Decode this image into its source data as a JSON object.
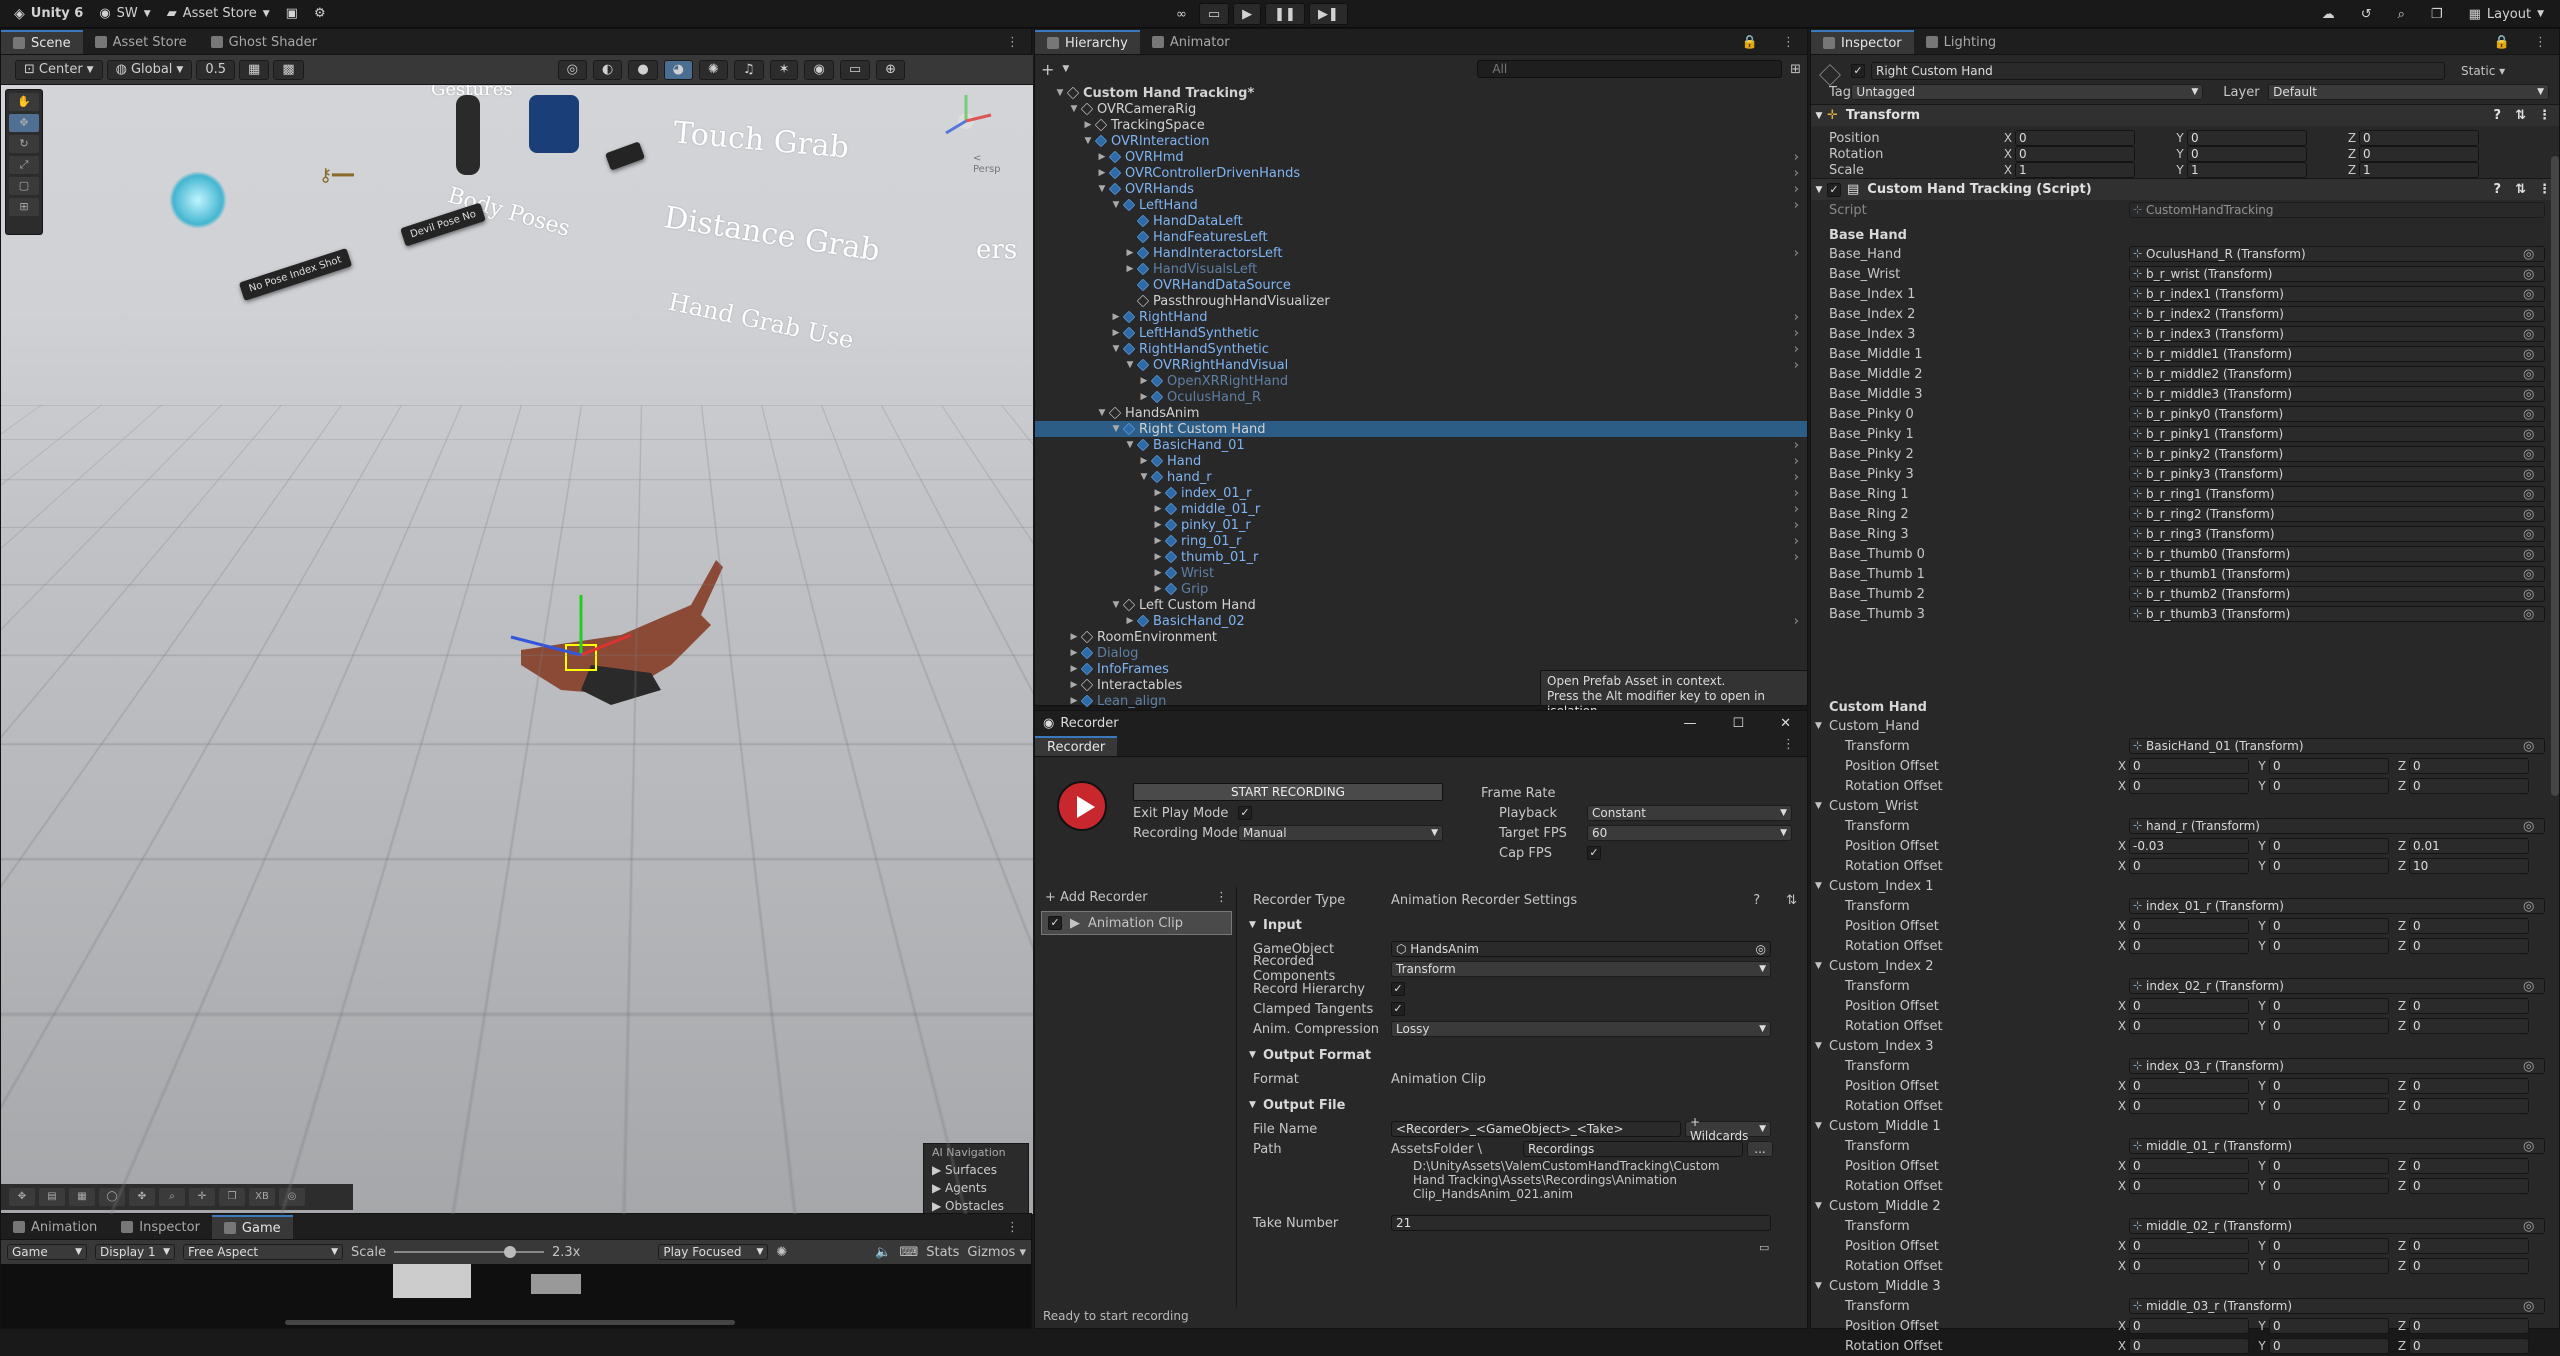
{
  "topbar": {
    "app": "Unity 6",
    "account": "SW",
    "asset_store": "Asset Store",
    "layout": "Layout"
  },
  "scene_tabs": [
    "Scene",
    "Asset Store",
    "Ghost Shader"
  ],
  "scene_toolbar": {
    "pivot": "Center",
    "space": "Global",
    "snap": "0.5"
  },
  "scene_world": {
    "labels": [
      "Touch Grab",
      "Distance Grab",
      "Hand Grab Use",
      "Body Poses",
      "Gestures",
      "ers"
    ],
    "persp": "< Persp",
    "signs": [
      "No Pose Index Shot",
      "Devil Pose No"
    ]
  },
  "scene_bottom_tools": [
    "XB"
  ],
  "navpanel": {
    "title": "AI Navigation",
    "items": [
      "Surfaces",
      "Agents",
      "Obstacles"
    ]
  },
  "game": {
    "tabs": [
      "Animation",
      "Inspector",
      "Game"
    ],
    "display_mode": "Game",
    "display": "Display 1",
    "aspect": "Free Aspect",
    "scale_label": "Scale",
    "scale_value": "2.3x",
    "play_mode": "Play Focused",
    "stats": "Stats",
    "gizmos": "Gizmos"
  },
  "hierarchy": {
    "tabs": [
      "Hierarchy",
      "Animator"
    ],
    "search_placeholder": "All",
    "rows": [
      {
        "name": "Custom Hand Tracking*",
        "depth": 0,
        "style": "bold",
        "arrow": "▼"
      },
      {
        "name": "OVRCameraRig",
        "depth": 1,
        "style": "",
        "arrow": "▼"
      },
      {
        "name": "TrackingSpace",
        "depth": 2,
        "style": "",
        "arrow": "▶"
      },
      {
        "name": "OVRInteraction",
        "depth": 2,
        "style": "blue",
        "arrow": "▼"
      },
      {
        "name": "OVRHmd",
        "depth": 3,
        "style": "blue",
        "arrow": "▶"
      },
      {
        "name": "OVRControllerDrivenHands",
        "depth": 3,
        "style": "blue",
        "arrow": "▶"
      },
      {
        "name": "OVRHands",
        "depth": 3,
        "style": "blue",
        "arrow": "▼"
      },
      {
        "name": "LeftHand",
        "depth": 4,
        "style": "blue",
        "arrow": "▼"
      },
      {
        "name": "HandDataLeft",
        "depth": 5,
        "style": "blue",
        "arrow": ""
      },
      {
        "name": "HandFeaturesLeft",
        "depth": 5,
        "style": "blue",
        "arrow": ""
      },
      {
        "name": "HandInteractorsLeft",
        "depth": 5,
        "style": "blue",
        "arrow": "▶"
      },
      {
        "name": "HandVisualsLeft",
        "depth": 5,
        "style": "dim",
        "arrow": "▶"
      },
      {
        "name": "OVRHandDataSource",
        "depth": 5,
        "style": "blue",
        "arrow": ""
      },
      {
        "name": "PassthroughHandVisualizer",
        "depth": 5,
        "style": "",
        "arrow": ""
      },
      {
        "name": "RightHand",
        "depth": 4,
        "style": "blue",
        "arrow": "▶"
      },
      {
        "name": "LeftHandSynthetic",
        "depth": 4,
        "style": "blue",
        "arrow": "▶"
      },
      {
        "name": "RightHandSynthetic",
        "depth": 4,
        "style": "blue",
        "arrow": "▼"
      },
      {
        "name": "OVRRightHandVisual",
        "depth": 5,
        "style": "blue",
        "arrow": "▼"
      },
      {
        "name": "OpenXRRightHand",
        "depth": 6,
        "style": "dim",
        "arrow": "▶"
      },
      {
        "name": "OculusHand_R",
        "depth": 6,
        "style": "dim",
        "arrow": "▶"
      },
      {
        "name": "HandsAnim",
        "depth": 3,
        "style": "",
        "arrow": "▼"
      },
      {
        "name": "Right Custom Hand",
        "depth": 4,
        "style": "sel",
        "arrow": "▼"
      },
      {
        "name": "BasicHand_01",
        "depth": 5,
        "style": "blue",
        "arrow": "▼"
      },
      {
        "name": "Hand",
        "depth": 6,
        "style": "blue",
        "arrow": "▶"
      },
      {
        "name": "hand_r",
        "depth": 6,
        "style": "blue",
        "arrow": "▼"
      },
      {
        "name": "index_01_r",
        "depth": 7,
        "style": "blue",
        "arrow": "▶"
      },
      {
        "name": "middle_01_r",
        "depth": 7,
        "style": "blue",
        "arrow": "▶"
      },
      {
        "name": "pinky_01_r",
        "depth": 7,
        "style": "blue",
        "arrow": "▶"
      },
      {
        "name": "ring_01_r",
        "depth": 7,
        "style": "blue",
        "arrow": "▶"
      },
      {
        "name": "thumb_01_r",
        "depth": 7,
        "style": "blue",
        "arrow": "▶"
      },
      {
        "name": "Wrist",
        "depth": 7,
        "style": "dim",
        "arrow": "▶"
      },
      {
        "name": "Grip",
        "depth": 7,
        "style": "dim",
        "arrow": "▶"
      },
      {
        "name": "Left Custom Hand",
        "depth": 4,
        "style": "",
        "arrow": "▼"
      },
      {
        "name": "BasicHand_02",
        "depth": 5,
        "style": "blue",
        "arrow": "▶"
      },
      {
        "name": "RoomEnvironment",
        "depth": 1,
        "style": "",
        "arrow": "▶"
      },
      {
        "name": "Dialog",
        "depth": 1,
        "style": "dim",
        "arrow": "▶"
      },
      {
        "name": "InfoFrames",
        "depth": 1,
        "style": "blue",
        "arrow": "▶"
      },
      {
        "name": "Interactables",
        "depth": 1,
        "style": "",
        "arrow": "▶"
      },
      {
        "name": "Lean_align",
        "depth": 1,
        "style": "dim",
        "arrow": "▶"
      }
    ],
    "tooltip": [
      "Open Prefab Asset in context.",
      "Press the Alt modifier key to open in isolation."
    ]
  },
  "recorder": {
    "window_title": "Recorder",
    "tab": "Recorder",
    "start_button": "START RECORDING",
    "exit_play_mode": "Exit Play Mode",
    "recording_mode_label": "Recording Mode",
    "recording_mode": "Manual",
    "frame_rate": "Frame Rate",
    "playback_label": "Playback",
    "playback": "Constant",
    "target_fps_label": "Target FPS",
    "target_fps": "60",
    "cap_fps": "Cap FPS",
    "add_recorder": "+ Add Recorder",
    "recorder_item": "Animation Clip",
    "recorder_type_label": "Recorder Type",
    "recorder_type": "Animation Recorder Settings",
    "input": "Input",
    "gameobject_label": "GameObject",
    "gameobject": "HandsAnim",
    "recorded_components_label": "Recorded Components",
    "recorded_components": "Transform",
    "record_hierarchy": "Record Hierarchy",
    "clamped_tangents": "Clamped Tangents",
    "anim_compression_label": "Anim. Compression",
    "anim_compression": "Lossy",
    "output_format": "Output Format",
    "format_label": "Format",
    "format": "Animation Clip",
    "output_file": "Output File",
    "file_name_label": "File Name",
    "file_name": "<Recorder>_<GameObject>_<Take>",
    "wildcards": "+ Wildcards",
    "path_label": "Path",
    "path_root": "AssetsFolder \\",
    "path_folder": "Recordings",
    "path_browse": "...",
    "full_path": [
      "D:\\UnityAssets\\ValemCustomHandTracking\\Custom",
      "Hand Tracking\\Assets\\Recordings\\Animation",
      "Clip_HandsAnim_021.anim"
    ],
    "take_number_label": "Take Number",
    "take_number": "21",
    "status": "Ready to start recording"
  },
  "inspector": {
    "tabs": [
      "Inspector",
      "Lighting"
    ],
    "object_name": "Right Custom Hand",
    "static": "Static",
    "tag_label": "Tag",
    "tag": "Untagged",
    "layer_label": "Layer",
    "layer": "Default",
    "transform_title": "Transform",
    "transform": [
      {
        "label": "Position",
        "x": "0",
        "y": "0",
        "z": "0"
      },
      {
        "label": "Rotation",
        "x": "0",
        "y": "0",
        "z": "0"
      },
      {
        "label": "Scale",
        "x": "1",
        "y": "1",
        "z": "1"
      }
    ],
    "script_title": "Custom Hand Tracking (Script)",
    "script_label": "Script",
    "script_value": "CustomHandTracking",
    "base_hand_header": "Base Hand",
    "base_fields": [
      {
        "label": "Base_Hand",
        "value": "OculusHand_R (Transform)"
      },
      {
        "label": "Base_Wrist",
        "value": "b_r_wrist (Transform)"
      },
      {
        "label": "Base_Index 1",
        "value": "b_r_index1 (Transform)"
      },
      {
        "label": "Base_Index 2",
        "value": "b_r_index2 (Transform)"
      },
      {
        "label": "Base_Index 3",
        "value": "b_r_index3 (Transform)"
      },
      {
        "label": "Base_Middle 1",
        "value": "b_r_middle1 (Transform)"
      },
      {
        "label": "Base_Middle 2",
        "value": "b_r_middle2 (Transform)"
      },
      {
        "label": "Base_Middle 3",
        "value": "b_r_middle3 (Transform)"
      },
      {
        "label": "Base_Pinky 0",
        "value": "b_r_pinky0 (Transform)"
      },
      {
        "label": "Base_Pinky 1",
        "value": "b_r_pinky1 (Transform)"
      },
      {
        "label": "Base_Pinky 2",
        "value": "b_r_pinky2 (Transform)"
      },
      {
        "label": "Base_Pinky 3",
        "value": "b_r_pinky3 (Transform)"
      },
      {
        "label": "Base_Ring 1",
        "value": "b_r_ring1 (Transform)"
      },
      {
        "label": "Base_Ring 2",
        "value": "b_r_ring2 (Transform)"
      },
      {
        "label": "Base_Ring 3",
        "value": "b_r_ring3 (Transform)"
      },
      {
        "label": "Base_Thumb 0",
        "value": "b_r_thumb0 (Transform)"
      },
      {
        "label": "Base_Thumb 1",
        "value": "b_r_thumb1 (Transform)"
      },
      {
        "label": "Base_Thumb 2",
        "value": "b_r_thumb2 (Transform)"
      },
      {
        "label": "Base_Thumb 3",
        "value": "b_r_thumb3 (Transform)"
      }
    ],
    "custom_hand_header": "Custom Hand",
    "custom_groups": [
      {
        "name": "Custom_Hand",
        "transform": "BasicHand_01 (Transform)",
        "pos": [
          "0",
          "0",
          "0"
        ],
        "rot": [
          "0",
          "0",
          "0"
        ]
      },
      {
        "name": "Custom_Wrist",
        "transform": "hand_r (Transform)",
        "pos": [
          "-0.03",
          "0",
          "0.01"
        ],
        "rot": [
          "0",
          "0",
          "10"
        ]
      },
      {
        "name": "Custom_Index 1",
        "transform": "index_01_r (Transform)",
        "pos": [
          "0",
          "0",
          "0"
        ],
        "rot": [
          "0",
          "0",
          "0"
        ]
      },
      {
        "name": "Custom_Index 2",
        "transform": "index_02_r (Transform)",
        "pos": [
          "0",
          "0",
          "0"
        ],
        "rot": [
          "0",
          "0",
          "0"
        ]
      },
      {
        "name": "Custom_Index 3",
        "transform": "index_03_r (Transform)",
        "pos": [
          "0",
          "0",
          "0"
        ],
        "rot": [
          "0",
          "0",
          "0"
        ]
      },
      {
        "name": "Custom_Middle 1",
        "transform": "middle_01_r (Transform)",
        "pos": [
          "0",
          "0",
          "0"
        ],
        "rot": [
          "0",
          "0",
          "0"
        ]
      },
      {
        "name": "Custom_Middle 2",
        "transform": "middle_02_r (Transform)",
        "pos": [
          "0",
          "0",
          "0"
        ],
        "rot": [
          "0",
          "0",
          "0"
        ]
      },
      {
        "name": "Custom_Middle 3",
        "transform": "middle_03_r (Transform)",
        "pos": [
          "0",
          "0",
          "0"
        ],
        "rot": [
          "0",
          "0",
          "0"
        ]
      }
    ],
    "sub_labels": {
      "transform": "Transform",
      "pos": "Position Offset",
      "rot": "Rotation Offset"
    }
  },
  "colors": {
    "accent": "#2c5d87",
    "prefab": "#7fb4f2",
    "record": "#c8282d"
  }
}
